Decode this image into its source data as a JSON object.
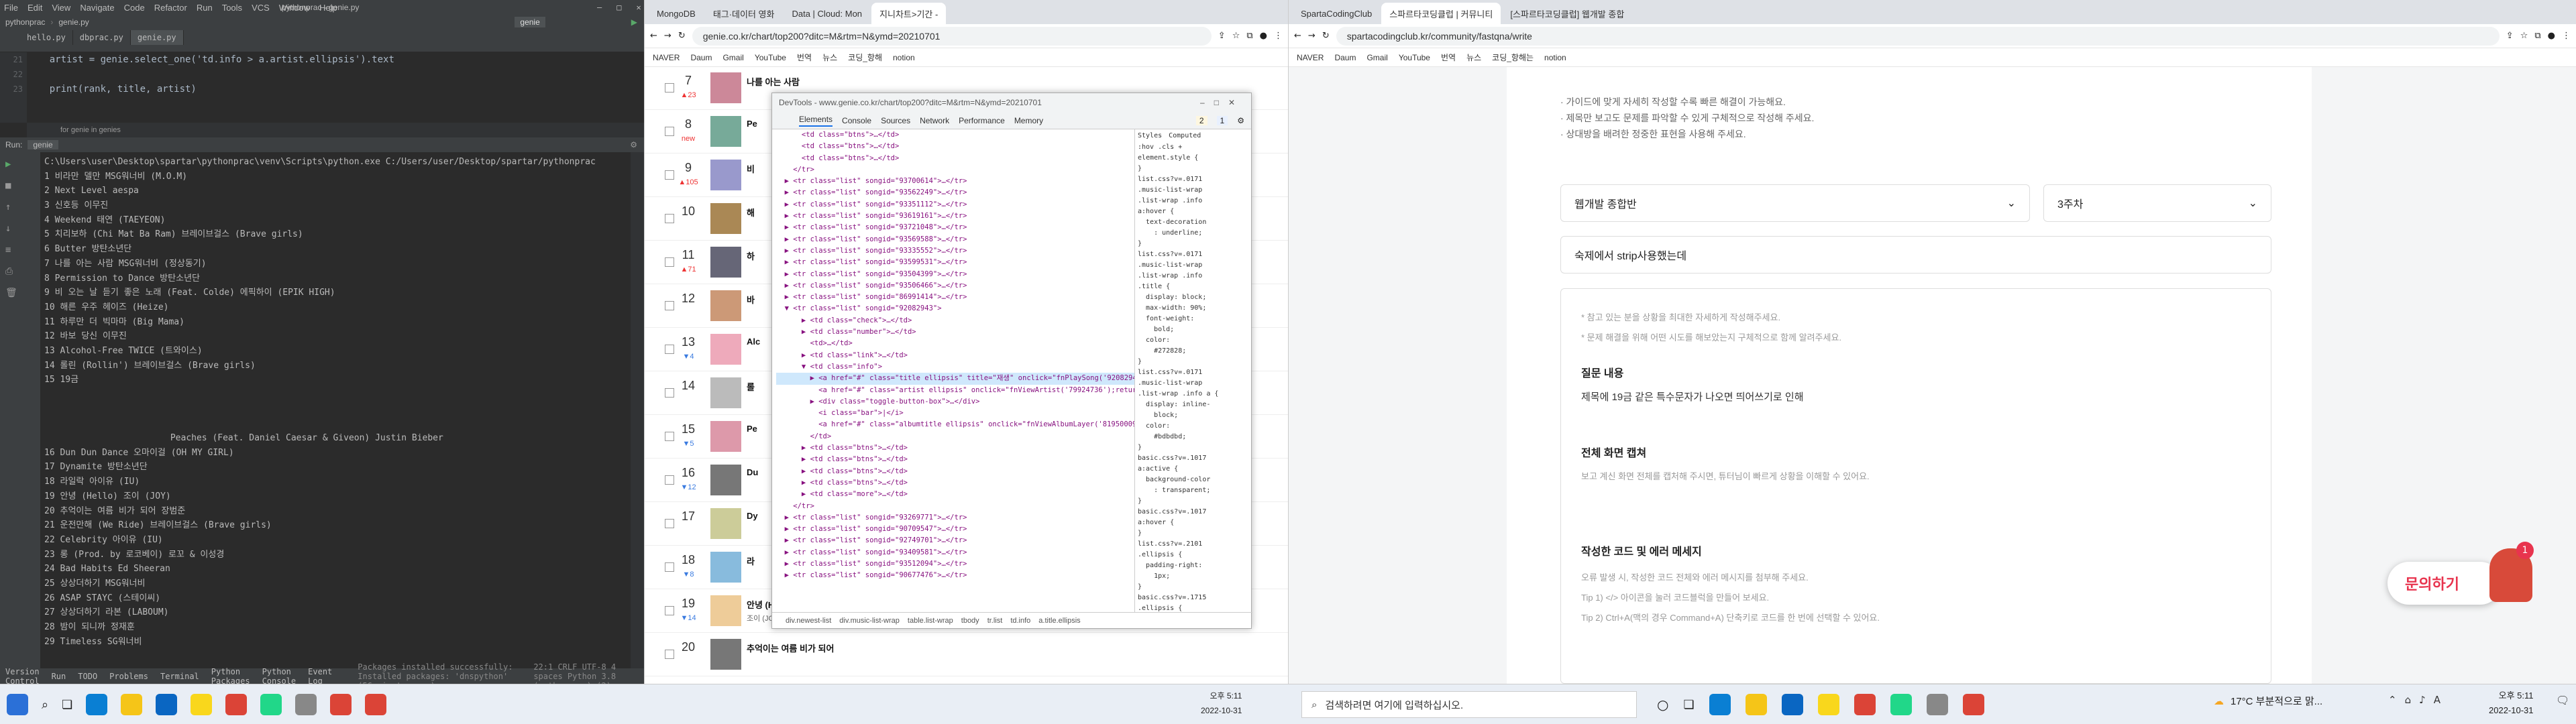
{
  "ide": {
    "menu": [
      "File",
      "Edit",
      "View",
      "Navigate",
      "Code",
      "Refactor",
      "Run",
      "Tools",
      "VCS",
      "Window",
      "Help"
    ],
    "title": "pythonprac - genie.py",
    "project": "pythonprac",
    "file": "genie.py",
    "tabs": [
      "hello.py",
      "dbprac.py",
      "genie.py"
    ],
    "code": [
      "    artist = genie.select_one('td.info > a.artist.ellipsis').text",
      "",
      "    print(rank, title, artist)"
    ],
    "gutter": [
      "21",
      "22",
      "23"
    ],
    "scope": "for genie in genies",
    "run_label": "Run:",
    "run_config": "genie",
    "output": [
      "C:\\Users\\user\\Desktop\\spartar\\pythonprac\\venv\\Scripts\\python.exe C:/Users/user/Desktop/spartar/pythonprac",
      "1 비라만 델만 MSG워너비 (M.O.M)",
      "2 Next Level aespa",
      "3 신호등 이무진",
      "4 Weekend 태연 (TAEYEON)",
      "5 치리보하 (Chi Mat Ba Ram) 브레이브걸스 (Brave girls)",
      "6 Butter 방탄소년단",
      "7 나를 아는 사람 MSG워너비 (정상동기)",
      "8 Permission to Dance 방탄소년단",
      "9 비 오는 날 듣기 좋은 노래 (Feat. Colde) 에픽하이 (EPIK HIGH)",
      "10 해른 우주 헤이즈 (Heize)",
      "11 하루만 더 빅마마 (Big Mama)",
      "12 바보 당신 이무진",
      "13 Alcohol-Free TWICE (트와이스)",
      "14 롤린 (Rollin') 브레이브걸스 (Brave girls)",
      "15 19금",
      "",
      "",
      "",
      "                        Peaches (Feat. Daniel Caesar & Giveon) Justin Bieber",
      "16 Dun Dun Dance 오마이걸 (OH MY GIRL)",
      "17 Dynamite 방탄소년단",
      "18 라일락 아이유 (IU)",
      "19 안녕 (Hello) 조이 (JOY)",
      "20 추억이는 여름 비가 되어 장범준",
      "21 운전만해 (We Ride) 브레이브걸스 (Brave girls)",
      "22 Celebrity 아이유 (IU)",
      "23 롱 (Prod. by 로코베이) 로꼬 & 이성경",
      "24 Bad Habits Ed Sheeran",
      "25 상상더하기 MSG워너비",
      "26 ASAP STAYC (스테이씨)",
      "27 상상더하기 라본 (LABOUM)",
      "28 밤이 되니까 정재훈",
      "29 Timeless SG워너비"
    ],
    "bottom_tabs": [
      "Version Control",
      "Run",
      "TODO",
      "Problems",
      "Terminal",
      "Python Packages",
      "Python Console",
      "Event Log"
    ],
    "status": "Packages installed successfully: Installed packages: 'dnspython' (56 minutes ago)",
    "status_right": "22:1  CRLF  UTF-8  4 spaces  Python 3.8 (pythonprac) (2)"
  },
  "browser1": {
    "tabs": [
      "MongoDB",
      "태그·데이터 영화",
      "Data | Cloud: Mon",
      "지니차트>기간 -"
    ],
    "url": "genie.co.kr/chart/top200?ditc=M&rtm=N&ymd=20210701",
    "bookmarks": [
      "NAVER",
      "Daum",
      "Gmail",
      "YouTube",
      "번역",
      "뉴스",
      "코딩_항해",
      "notion"
    ],
    "rows": [
      {
        "rank": "7",
        "chg": "▲23",
        "title": "나를 아는 사람",
        "artist": ""
      },
      {
        "rank": "8",
        "chg": "new",
        "title": "Pe",
        "artist": ""
      },
      {
        "rank": "9",
        "chg": "▲105",
        "title": "비",
        "artist": ""
      },
      {
        "rank": "10",
        "chg": "",
        "title": "해",
        "artist": ""
      },
      {
        "rank": "11",
        "chg": "▲71",
        "title": "하",
        "artist": ""
      },
      {
        "rank": "12",
        "chg": "",
        "title": "바",
        "artist": ""
      },
      {
        "rank": "13",
        "chg": "▼4",
        "title": "Alc",
        "artist": ""
      },
      {
        "rank": "14",
        "chg": "",
        "title": "롤",
        "artist": ""
      },
      {
        "rank": "15",
        "chg": "▼5",
        "title": "Pe",
        "artist": ""
      },
      {
        "rank": "16",
        "chg": "▼12",
        "title": "Du",
        "artist": ""
      },
      {
        "rank": "17",
        "chg": "",
        "title": "Dy",
        "artist": ""
      },
      {
        "rank": "18",
        "chg": "▼8",
        "title": "라",
        "artist": ""
      },
      {
        "rank": "19",
        "chg": "▼14",
        "title": "안녕 (Hello)",
        "artist": "조이 (JOY) · 안녕 (Hello) - Special Al"
      },
      {
        "rank": "20",
        "chg": "",
        "title": "추억이는 여름 비가 되어",
        "artist": ""
      }
    ]
  },
  "devtools": {
    "title": "DevTools - www.genie.co.kr/chart/top200?ditc=M&rtm=N&ymd=20210701",
    "tabs": [
      "Elements",
      "Console",
      "Sources",
      "Network",
      "Performance",
      "Memory"
    ],
    "badges": [
      "2",
      "1"
    ],
    "elements": [
      "      <td class=\"btns\">…</td>",
      "      <td class=\"btns\">…</td>",
      "      <td class=\"btns\">…</td>",
      "    </tr>",
      "  ▶ <tr class=\"list\" songid=\"93700614\">…</tr>",
      "  ▶ <tr class=\"list\" songid=\"93562249\">…</tr>",
      "  ▶ <tr class=\"list\" songid=\"93351112\">…</tr>",
      "  ▶ <tr class=\"list\" songid=\"93619161\">…</tr>",
      "  ▶ <tr class=\"list\" songid=\"93721048\">…</tr>",
      "  ▶ <tr class=\"list\" songid=\"93569588\">…</tr>",
      "  ▶ <tr class=\"list\" songid=\"93335552\">…</tr>",
      "  ▶ <tr class=\"list\" songid=\"93599531\">…</tr>",
      "  ▶ <tr class=\"list\" songid=\"93504399\">…</tr>",
      "  ▶ <tr class=\"list\" songid=\"93506466\">…</tr>",
      "  ▶ <tr class=\"list\" songid=\"86991414\">…</tr>",
      "  ▼ <tr class=\"list\" songid=\"92082943\">",
      "      ▶ <td class=\"check\">…</td>",
      "      ▶ <td class=\"number\">…</td>",
      "        <td>…</td>",
      "      ▶ <td class=\"link\">…</td>",
      "      ▼ <td class=\"info\">",
      "        ▶ <a href=\"#\" class=\"title ellipsis\" title=\"재생\" onclick=\"fnPlaySong('92082943','1');return false;\">…</a> == $0",
      "          <a href=\"#\" class=\"artist ellipsis\" onclick=\"fnViewArtist('79924736');return false;\">Justin Bieber</a>",
      "        ▶ <div class=\"toggle-button-box\">…</div>",
      "          <i class=\"bar\">|</i>",
      "          <a href=\"#\" class=\"albumtitle ellipsis\" onclick=\"fnViewAlbumLayer('81950009');return false;\">Justice</a>",
      "        </td>",
      "      ▶ <td class=\"btns\">…</td>",
      "      ▶ <td class=\"btns\">…</td>",
      "      ▶ <td class=\"btns\">…</td>",
      "      ▶ <td class=\"btns\">…</td>",
      "      ▶ <td class=\"more\">…</td>",
      "    </tr>",
      "  ▶ <tr class=\"list\" songid=\"93269771\">…</tr>",
      "  ▶ <tr class=\"list\" songid=\"90709547\">…</tr>",
      "  ▶ <tr class=\"list\" songid=\"92749701\">…</tr>",
      "  ▶ <tr class=\"list\" songid=\"93409581\">…</tr>",
      "  ▶ <tr class=\"list\" songid=\"93512094\">…</tr>",
      "  ▶ <tr class=\"list\" songid=\"90677476\">…</tr>"
    ],
    "styles_tabs": [
      "Styles",
      "Computed"
    ],
    "styles": [
      ":hov .cls +",
      "element.style {",
      "}",
      "list.css?v=.0171",
      ".music-list-wrap",
      ".list-wrap .info",
      "a:hover {",
      "  text-decoration",
      "    : underline;",
      "}",
      "list.css?v=.0171",
      ".music-list-wrap",
      ".list-wrap .info",
      ".title {",
      "  display: block;",
      "  max-width: 90%;",
      "  font-weight:",
      "    bold;",
      "  color:",
      "    #272828;",
      "}",
      "list.css?v=.0171",
      ".music-list-wrap",
      ".list-wrap .info a {",
      "  display: inline-",
      "    block;",
      "  color:",
      "    #bdbdbd;",
      "}",
      "basic.css?v=.1017",
      "a:active {",
      "  background-color",
      "    : transparent;",
      "}",
      "basic.css?v=.1017",
      "a:hover {",
      "}",
      "list.css?v=.2101",
      ".ellipsis {",
      "  padding-right:",
      "    1px;",
      "}",
      "basic.css?v=.1715",
      ".ellipsis {"
    ],
    "breadcrumb": [
      "div.newest-list",
      "div.music-list-wrap",
      "table.list-wrap",
      "tbody",
      "tr.list",
      "td.info",
      "a.title.ellipsis"
    ]
  },
  "browser2": {
    "tabs": [
      "SpartaCodingClub",
      "스파르타코딩클럽 | 커뮤니티",
      "[스파르타코딩클럽] 웹개발 종합"
    ],
    "url": "spartacodingclub.kr/community/fastqna/write",
    "bookmarks": [
      "NAVER",
      "Daum",
      "Gmail",
      "YouTube",
      "번역",
      "뉴스",
      "코딩_항해는",
      "notion"
    ],
    "guides": [
      "· 가이드에 맞게 자세히 작성할 수록 빠른 해결이 가능해요.",
      "· 제목만 보고도 문제를 파악할 수 있게 구체적으로 작성해 주세요.",
      "· 상대방을 배려한 정중한 표현을 사용해 주세요."
    ],
    "course_select": "웹개발 종합반",
    "week_select": "3주차",
    "title_value": "숙제에서 strip사용했는데",
    "desc_hints": [
      "* 참고 있는 분을 상황을 최대한 자세하게 작성해주세요.",
      "* 문제 해결을 위해 어떤 시도를 해보았는지 구체적으로 함께 알려주세요."
    ],
    "question_heading": "질문 내용",
    "question_body": "제목에 19금 같은 특수문자가 나오면 띄어쓰기로 인해",
    "capture_heading": "전체 화면 캡쳐",
    "capture_hint": "보고 계신 화면 전체를 캡처해 주시면, 튜터님이 빠르게 상황을 이해할 수 있어요.",
    "code_heading": "작성한 코드 및 에러 메세지",
    "code_hints": [
      "오류 발생 시, 작성한 코드 전체와 에러 메시지를 첨부해 주세요.",
      "Tip 1) </> 아이콘을 눌러 코드블럭을 만들어 보세요.",
      "Tip 2) Ctrl+A(맥의 경우 Command+A) 단축키로 코드를 한 번에 선택할 수 있어요."
    ],
    "ask_button": "문의하기",
    "ask_badge": "1"
  },
  "taskbar": {
    "search_placeholder": "검색하려면 여기에 입력하십시오.",
    "left_time": "오후 5:11",
    "left_date": "2022-10-31",
    "weather": "17°C 부분적으로 맑...",
    "right_time": "오후 5:11",
    "right_date": "2022-10-31"
  },
  "colors": {
    "ide_bg": "#2b2b2b",
    "accent_red": "#e8344e",
    "devtools_accent": "#1a73e8"
  }
}
